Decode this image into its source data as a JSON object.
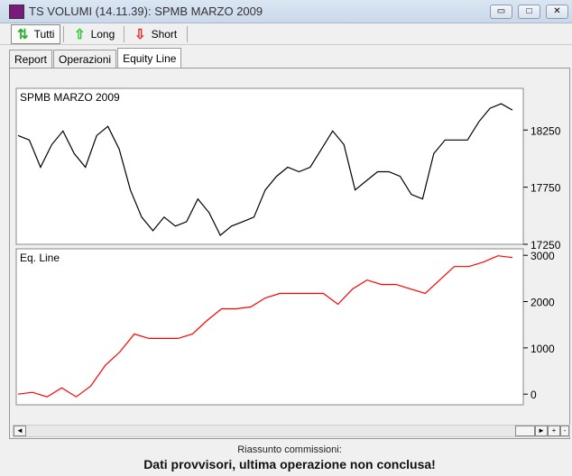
{
  "window": {
    "title": "TS VOLUMI (14.11.39): SPMB MARZO 2009",
    "minimize": "▭",
    "maximize": "□",
    "close": "✕"
  },
  "toolbar": [
    {
      "label": "Tutti",
      "icon": "up-down-arrow-icon"
    },
    {
      "label": "Long",
      "icon": "green-up-arrow-icon"
    },
    {
      "label": "Short",
      "icon": "red-down-arrow-icon"
    }
  ],
  "tabs": [
    {
      "label": "Report"
    },
    {
      "label": "Operazioni"
    },
    {
      "label": "Equity Line",
      "selected": true
    }
  ],
  "footer": {
    "line1": "Riassunto commissioni:",
    "line2": "Dati provvisori, ultima operazione non conclusa!"
  },
  "scrollbar": {
    "left": "◄",
    "right": "►",
    "plus": "+",
    "minus": "-"
  },
  "chart_data": [
    {
      "type": "line",
      "title": "SPMB MARZO 2009",
      "color": "#000000",
      "ylim": [
        17250,
        18615
      ],
      "yticks": [
        17250,
        17750,
        18250
      ],
      "ytick_labels": [
        "17250",
        "17750",
        "18250"
      ],
      "values": [
        18202,
        18163,
        17925,
        18123,
        18242,
        18044,
        17925,
        18202,
        18282,
        18083,
        17726,
        17488,
        17369,
        17488,
        17409,
        17448,
        17647,
        17528,
        17329,
        17409,
        17448,
        17488,
        17726,
        17845,
        17925,
        17885,
        17925,
        18083,
        18242,
        18123,
        17726,
        17806,
        17885,
        17885,
        17845,
        17686,
        17647,
        18044,
        18163,
        18163,
        18163,
        18321,
        18441,
        18480,
        18425
      ]
    },
    {
      "type": "line",
      "title": "Eq. Line",
      "color": "#ff0000",
      "ylim": [
        -230,
        3140
      ],
      "yticks": [
        0,
        1000,
        2000,
        3000
      ],
      "ytick_labels": [
        "0",
        "1000",
        "2000",
        "3000"
      ],
      "values": [
        0,
        39,
        -58,
        136,
        -58,
        175,
        621,
        912,
        1300,
        1204,
        1204,
        1204,
        1300,
        1592,
        1845,
        1845,
        1883,
        2078,
        2175,
        2175,
        2175,
        2175,
        1942,
        2272,
        2466,
        2369,
        2369,
        2272,
        2175,
        2466,
        2757,
        2757,
        2854,
        2990,
        2951
      ]
    }
  ]
}
